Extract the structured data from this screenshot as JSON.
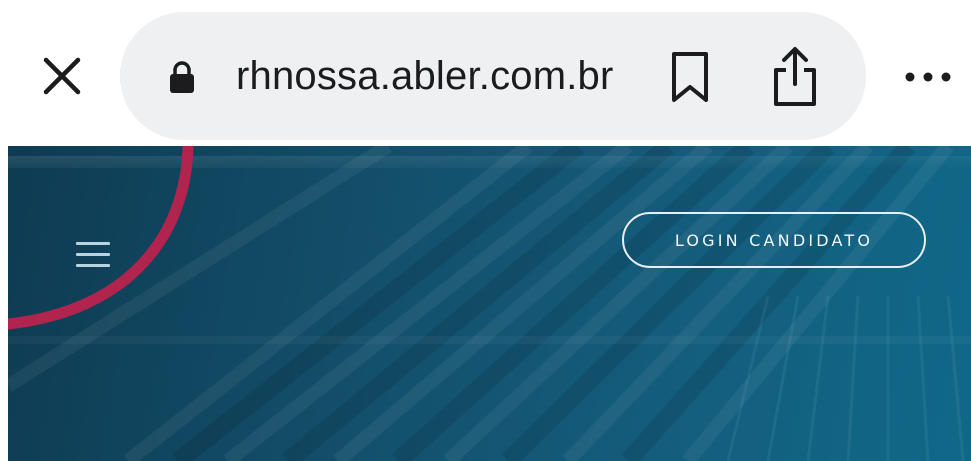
{
  "browser": {
    "url": "rhnossa.abler.com.br",
    "icons": {
      "close": "close-icon",
      "lock": "lock-icon",
      "bookmark": "bookmark-icon",
      "share": "share-icon",
      "more": "more-icon"
    }
  },
  "header": {
    "login_label": "LOGIN CANDIDATO",
    "menu_icon": "hamburger-menu-icon"
  },
  "colors": {
    "hero_dark": "#0e3b52",
    "hero_light": "#106889",
    "accent_arc": "#b0244e",
    "url_pill": "#eef0f2"
  }
}
